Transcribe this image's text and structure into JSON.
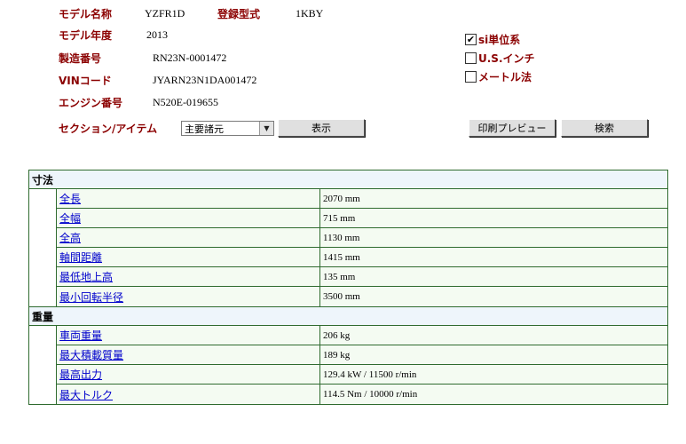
{
  "info": {
    "model_name_label": "モデル名称",
    "model_name": "YZFR1D",
    "reg_type_label": "登録型式",
    "reg_type": "1KBY",
    "model_year_label": "モデル年度",
    "model_year": "2013",
    "serial_label": "製造番号",
    "serial": "RN23N-0001472",
    "vin_label": "VINコード",
    "vin": "JYARN23N1DA001472",
    "engine_label": "エンジン番号",
    "engine": "N520E-019655",
    "section_label": "セクション/アイテム"
  },
  "units": {
    "si_label": "si単位系",
    "si_checked": true,
    "us_label": "U.S.インチ",
    "us_checked": false,
    "metric_label": "メートル法",
    "metric_checked": false
  },
  "controls": {
    "section_select": "主要諸元",
    "show_button": "表示",
    "print_button": "印刷プレビュー",
    "search_button": "検索"
  },
  "spec": {
    "sections": [
      {
        "title": "寸法",
        "rows": [
          {
            "name": "全長",
            "value": "2070 mm"
          },
          {
            "name": "全幅",
            "value": "715 mm"
          },
          {
            "name": "全高",
            "value": "1130 mm"
          },
          {
            "name": "軸間距離",
            "value": "1415 mm"
          },
          {
            "name": "最低地上高",
            "value": "135 mm"
          },
          {
            "name": "最小回転半径",
            "value": "3500 mm"
          }
        ]
      },
      {
        "title": "重量",
        "rows": [
          {
            "name": "車両重量",
            "value": "206 kg"
          },
          {
            "name": "最大積載質量",
            "value": "189 kg"
          },
          {
            "name": "最高出力",
            "value": "129.4 kW / 11500 r/min"
          },
          {
            "name": "最大トルク",
            "value": "114.5 Nm / 10000 r/min"
          }
        ]
      }
    ]
  }
}
